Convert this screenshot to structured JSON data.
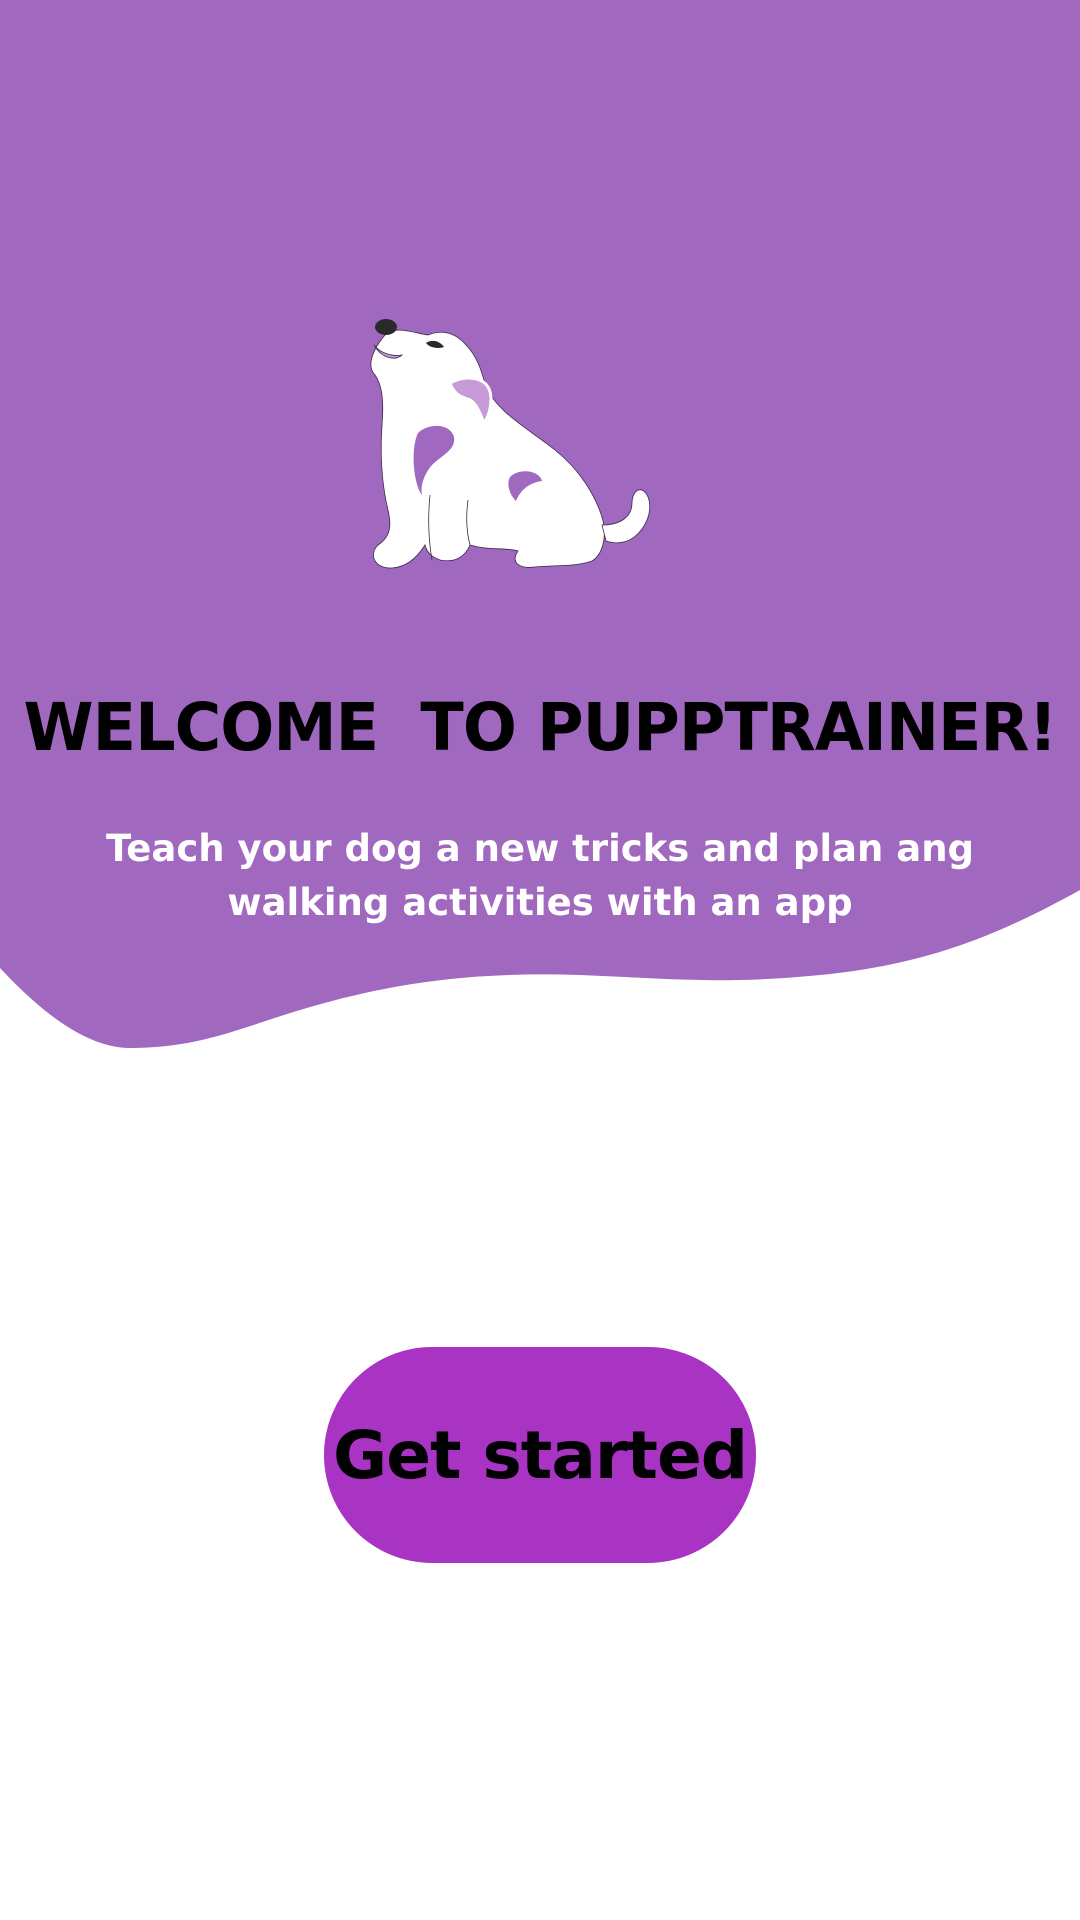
{
  "colors": {
    "hero_background": "#a068bf",
    "button_background": "#a933c2",
    "title_text": "#000000",
    "subtitle_text": "#ffffff"
  },
  "hero": {
    "illustration_icon": "sitting-dog-icon",
    "title": "WELCOME  TO PUPPTRAINER!",
    "subtitle": "Teach your dog a new tricks and plan ang walking activities with an app"
  },
  "actions": {
    "get_started_label": "Get started"
  }
}
